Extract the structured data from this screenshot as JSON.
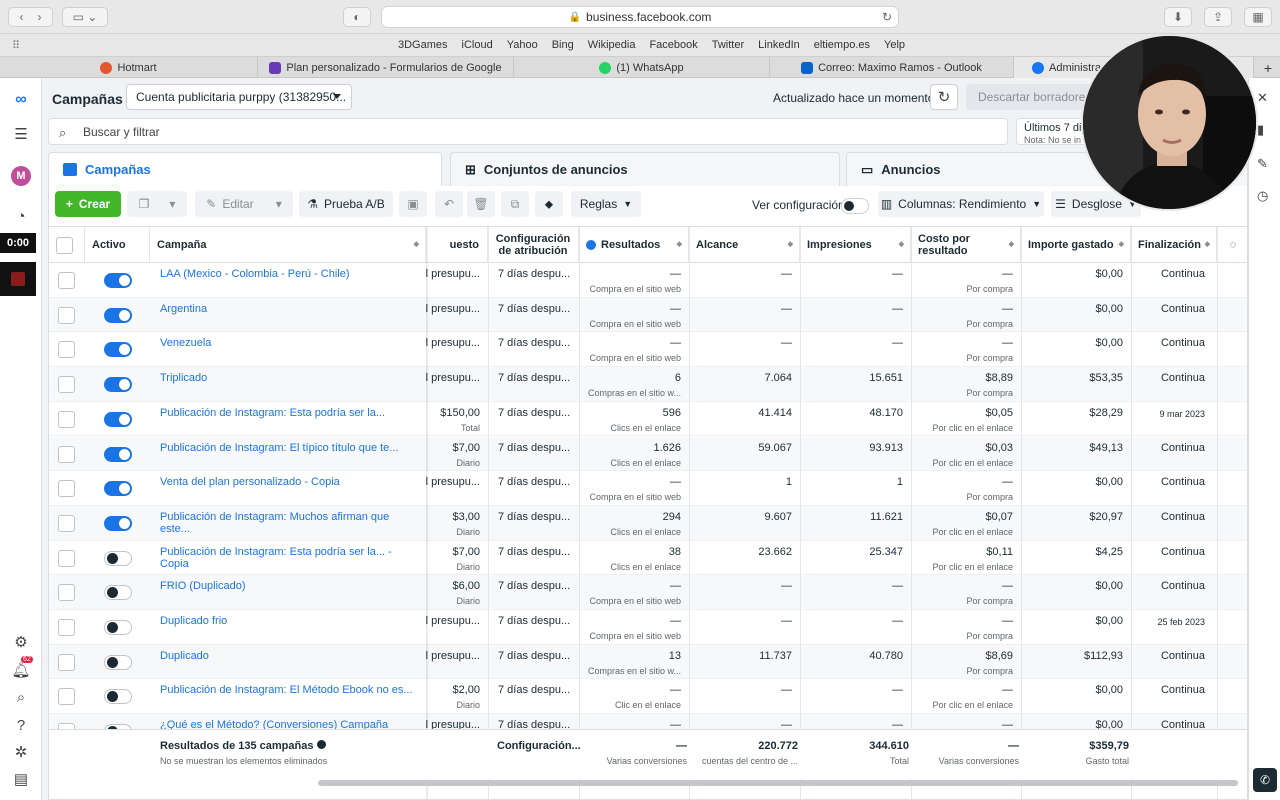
{
  "browser": {
    "url": "business.facebook.com",
    "favorites": [
      "3DGames",
      "iCloud",
      "Yahoo",
      "Bing",
      "Wikipedia",
      "Facebook",
      "Twitter",
      "LinkedIn",
      "eltiempo.es",
      "Yelp"
    ],
    "tabs": [
      {
        "label": "Hotmart",
        "color": "#e4572e"
      },
      {
        "label": "Plan personalizado - Formularios de Google",
        "color": "#673ab7"
      },
      {
        "label": "(1) WhatsApp",
        "color": "#25d366"
      },
      {
        "label": "Correo: Maximo Ramos - Outlook",
        "color": "#0a64c8"
      },
      {
        "label": "Administrad",
        "color": "#1877f2"
      }
    ]
  },
  "recorder": {
    "timer": "0:00"
  },
  "leftnav": {
    "avatar_letter": "M",
    "notif_count": "62"
  },
  "header": {
    "title": "Campañas",
    "account": "Cuenta publicitaria purppy (31382950...",
    "updated": "Actualizado hace un momento",
    "discard": "Descartar borradores"
  },
  "search": {
    "placeholder": "Buscar y filtrar"
  },
  "daterange": {
    "label": "Últimos 7 di",
    "note": "Nota: No se in"
  },
  "level_tabs": {
    "campaigns": "Campañas",
    "adsets": "Conjuntos de anuncios",
    "ads": "Anuncios"
  },
  "toolbar": {
    "create": "Crear",
    "edit": "Editar",
    "ab_test": "Prueba A/B",
    "rules": "Reglas",
    "view_config": "Ver configuración",
    "columns": "Columnas: Rendimiento",
    "breakdown": "Desglose"
  },
  "columns": {
    "active": "Activo",
    "campaign": "Campaña",
    "budget": "uesto",
    "attribution": "Configuración de atribución",
    "results": "Resultados",
    "reach": "Alcance",
    "impressions": "Impresiones",
    "cost": "Costo por resultado",
    "spent": "Importe gastado",
    "end": "Finalización"
  },
  "rows": [
    {
      "name": "LAA (Mexico - Colombia - Perú - Chile)",
      "on": true,
      "budget": "el presupu...",
      "budget_sub": "",
      "attr": "7 días despu...",
      "res": "—",
      "res_sub": "Compra en el sitio web",
      "reach": "—",
      "impr": "—",
      "cost": "—",
      "cost_sub": "Por compra",
      "spent": "$0,00",
      "end": "Continua"
    },
    {
      "name": "Argentina",
      "on": true,
      "budget": "el presupu...",
      "budget_sub": "",
      "attr": "7 días despu...",
      "res": "—",
      "res_sub": "Compra en el sitio web",
      "reach": "—",
      "impr": "—",
      "cost": "—",
      "cost_sub": "Por compra",
      "spent": "$0,00",
      "end": "Continua"
    },
    {
      "name": "Venezuela",
      "on": true,
      "budget": "el presupu...",
      "budget_sub": "",
      "attr": "7 días despu...",
      "res": "—",
      "res_sub": "Compra en el sitio web",
      "reach": "—",
      "impr": "—",
      "cost": "—",
      "cost_sub": "Por compra",
      "spent": "$0,00",
      "end": "Continua"
    },
    {
      "name": "Triplicado",
      "on": true,
      "budget": "el presupu...",
      "budget_sub": "",
      "attr": "7 días despu...",
      "res": "6",
      "res_sub": "Compras en el sitio w...",
      "reach": "7.064",
      "impr": "15.651",
      "cost": "$8,89",
      "cost_sub": "Por compra",
      "spent": "$53,35",
      "end": "Continua"
    },
    {
      "name": "Publicación de Instagram: Esta podría ser la...",
      "on": true,
      "budget": "$150,00",
      "budget_sub": "Total",
      "attr": "7 días despu...",
      "res": "596",
      "res_sub": "Clics en el enlace",
      "reach": "41.414",
      "impr": "48.170",
      "cost": "$0,05",
      "cost_sub": "Por clic en el enlace",
      "spent": "$28,29",
      "end": "9 mar 2023"
    },
    {
      "name": "Publicación de Instagram: El típico título que te...",
      "on": true,
      "budget": "$7,00",
      "budget_sub": "Diario",
      "attr": "7 días despu...",
      "res": "1.626",
      "res_sub": "Clics en el enlace",
      "reach": "59.067",
      "impr": "93.913",
      "cost": "$0,03",
      "cost_sub": "Por clic en el enlace",
      "spent": "$49,13",
      "end": "Continua"
    },
    {
      "name": "Venta del plan personalizado - Copia",
      "on": true,
      "budget": "el presupu...",
      "budget_sub": "",
      "attr": "7 días despu...",
      "res": "—",
      "res_sub": "Compra en el sitio web",
      "reach": "1",
      "impr": "1",
      "cost": "—",
      "cost_sub": "Por compra",
      "spent": "$0,00",
      "end": "Continua"
    },
    {
      "name": "Publicación de Instagram: Muchos afirman que este...",
      "on": true,
      "budget": "$3,00",
      "budget_sub": "Diario",
      "attr": "7 días despu...",
      "res": "294",
      "res_sub": "Clics en el enlace",
      "reach": "9.607",
      "impr": "11.621",
      "cost": "$0,07",
      "cost_sub": "Por clic en el enlace",
      "spent": "$20,97",
      "end": "Continua"
    },
    {
      "name": "Publicación de Instagram: Esta podría ser la... - Copia",
      "on": false,
      "budget": "$7,00",
      "budget_sub": "Diario",
      "attr": "7 días despu...",
      "res": "38",
      "res_sub": "Clics en el enlace",
      "reach": "23.662",
      "impr": "25.347",
      "cost": "$0,11",
      "cost_sub": "Por clic en el enlace",
      "spent": "$4,25",
      "end": "Continua"
    },
    {
      "name": "FRIO (Duplicado)",
      "on": false,
      "budget": "$6,00",
      "budget_sub": "Diario",
      "attr": "7 días despu...",
      "res": "—",
      "res_sub": "Compra en el sitio web",
      "reach": "—",
      "impr": "—",
      "cost": "—",
      "cost_sub": "Por compra",
      "spent": "$0,00",
      "end": "Continua"
    },
    {
      "name": "Duplicado frio",
      "on": false,
      "budget": "el presupu...",
      "budget_sub": "",
      "attr": "7 días despu...",
      "res": "—",
      "res_sub": "Compra en el sitio web",
      "reach": "—",
      "impr": "—",
      "cost": "—",
      "cost_sub": "Por compra",
      "spent": "$0,00",
      "end": "25 feb 2023"
    },
    {
      "name": "Duplicado",
      "on": false,
      "budget": "el presupu...",
      "budget_sub": "",
      "attr": "7 días despu...",
      "res": "13",
      "res_sub": "Compras en el sitio w...",
      "reach": "11.737",
      "impr": "40.780",
      "cost": "$8,69",
      "cost_sub": "Por compra",
      "spent": "$112,93",
      "end": "Continua"
    },
    {
      "name": "Publicación de Instagram: El Método Ebook no es...",
      "on": false,
      "budget": "$2,00",
      "budget_sub": "Diario",
      "attr": "7 días despu...",
      "res": "—",
      "res_sub": "Clic en el enlace",
      "reach": "—",
      "impr": "—",
      "cost": "—",
      "cost_sub": "Por clic en el enlace",
      "spent": "$0,00",
      "end": "Continua"
    },
    {
      "name": "¿Qué es el Método? (Conversiones) Campaña",
      "on": false,
      "budget": "el presupu...",
      "budget_sub": "",
      "attr": "7 días despu...",
      "res": "—",
      "res_sub": "",
      "reach": "—",
      "impr": "—",
      "cost": "—",
      "cost_sub": "",
      "spent": "$0,00",
      "end": "Continua"
    }
  ],
  "footer": {
    "title": "Resultados de 135 campañas",
    "sub": "No se muestran los elementos eliminados",
    "attr": "Configuración...",
    "res": "—",
    "res_sub": "Varias conversiones",
    "reach": "220.772",
    "reach_sub": "cuentas del centro de ...",
    "impr": "344.610",
    "impr_sub": "Total",
    "cost": "—",
    "cost_sub": "Varias conversiones",
    "spent": "$359,79",
    "spent_sub": "Gasto total"
  }
}
